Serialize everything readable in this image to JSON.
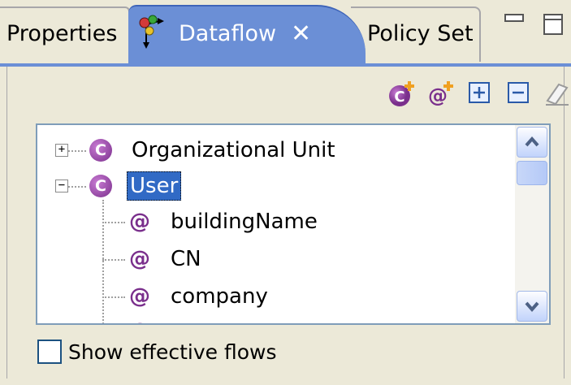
{
  "tabs": {
    "properties": "Properties",
    "dataflow": "Dataflow",
    "close": "✕",
    "policy_set": "Policy Set"
  },
  "toolbar": {
    "icons": [
      "add-class-icon",
      "add-attribute-icon",
      "expand-all-icon",
      "collapse-all-icon",
      "eraser-icon"
    ]
  },
  "tree": {
    "nodes": [
      {
        "label": "Organizational Unit",
        "type": "class",
        "expanded": false
      },
      {
        "label": "User",
        "type": "class",
        "expanded": true,
        "selected": true
      },
      {
        "label": "buildingName",
        "type": "attribute"
      },
      {
        "label": "CN",
        "type": "attribute"
      },
      {
        "label": "company",
        "type": "attribute"
      }
    ],
    "class_glyph": "C",
    "attr_glyph": "@",
    "expander_plus": "+",
    "expander_minus": "−"
  },
  "options": {
    "show_effective_flows": "Show effective flows",
    "show_effective_flows_checked": false
  },
  "colors": {
    "active_tab": "#6b8fd6",
    "selection": "#316ac5",
    "class_icon": "#7a2f8c"
  }
}
